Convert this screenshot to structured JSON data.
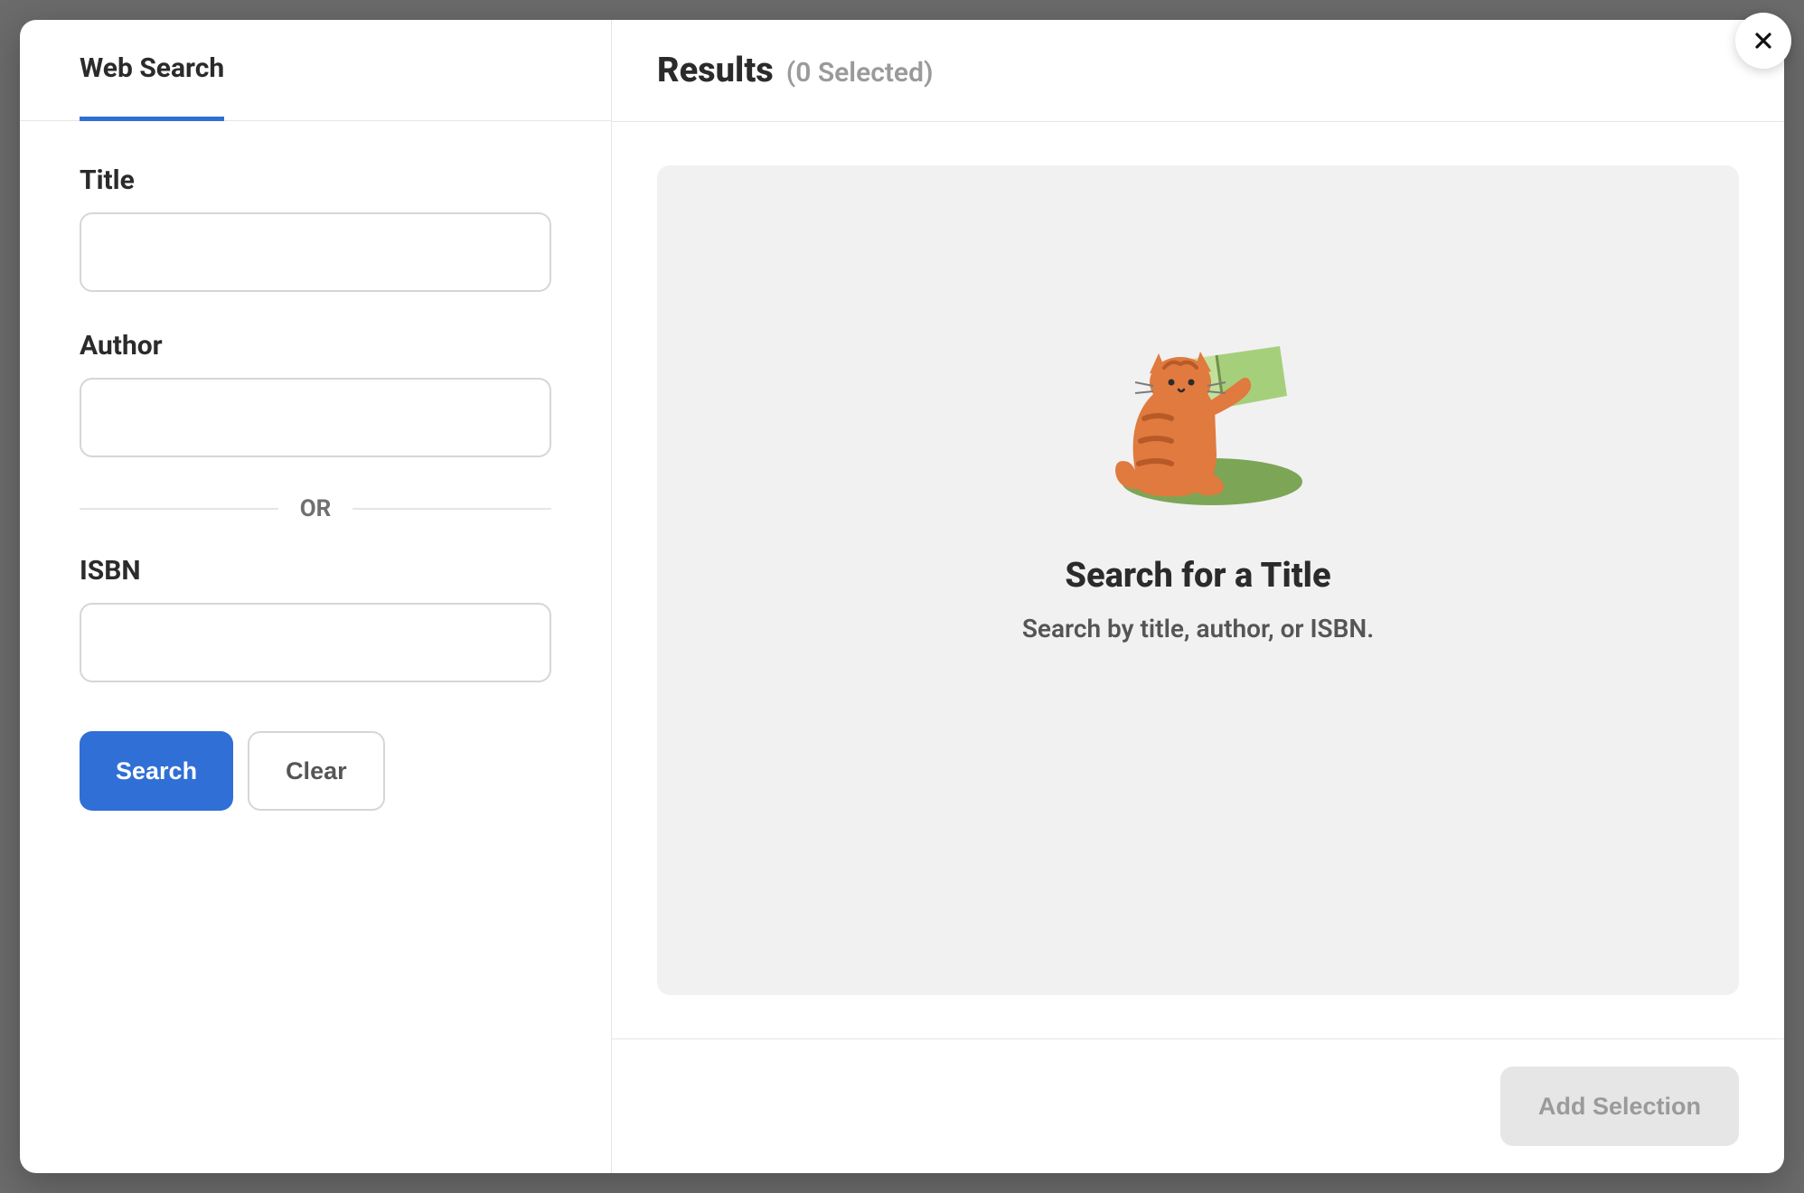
{
  "tabs": {
    "web_search": "Web Search"
  },
  "form": {
    "title_label": "Title",
    "title_value": "",
    "author_label": "Author",
    "author_value": "",
    "or_label": "OR",
    "isbn_label": "ISBN",
    "isbn_value": "",
    "search_button": "Search",
    "clear_button": "Clear"
  },
  "results": {
    "header_title": "Results",
    "selected_count_text": "(0 Selected)",
    "empty_title": "Search for a Title",
    "empty_subtitle": "Search by title, author, or ISBN."
  },
  "footer": {
    "add_selection": "Add Selection"
  }
}
